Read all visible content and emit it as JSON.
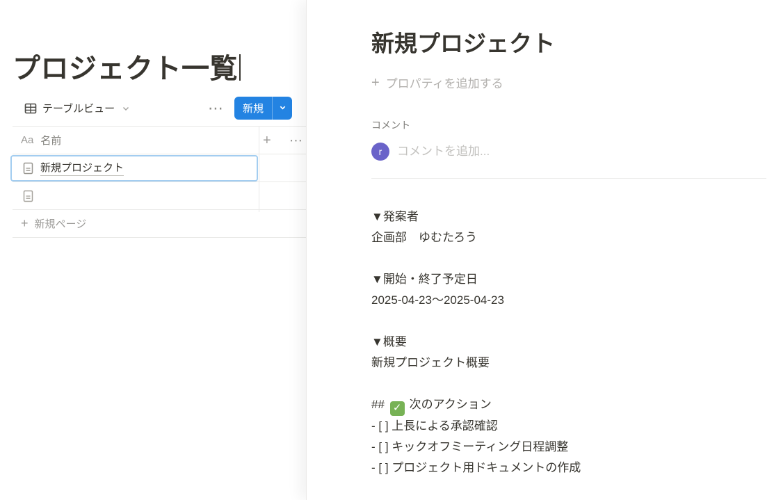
{
  "left_pane": {
    "page_title": "プロジェクト一覧",
    "toolbar": {
      "view_tab": "テーブルビュー",
      "new_button": "新規"
    },
    "table": {
      "header": {
        "type_badge": "Aa",
        "name_column": "名前"
      },
      "rows": [
        {
          "title": "新規プロジェクト"
        },
        {
          "title": ""
        }
      ],
      "new_page_label": "新規ページ"
    }
  },
  "side_peek": {
    "page_title": "新規プロジェクト",
    "add_property_label": "プロパティを追加する",
    "comments": {
      "section_label": "コメント",
      "avatar_initial": "r",
      "placeholder": "コメントを追加..."
    },
    "body": {
      "proposer_heading": "▼発案者",
      "proposer_value": "企画部　ゆむたろう",
      "dates_heading": "▼開始・終了予定日",
      "dates_value": "2025-04-23〜2025-04-23",
      "summary_heading": "▼概要",
      "summary_value": "新規プロジェクト概要",
      "actions_heading_prefix": "## ",
      "actions_emoji_glyph": "✓",
      "actions_heading_text": "次のアクション",
      "todo_items": [
        "- [ ] 上長による承認確認",
        "- [ ] キックオフミーティング日程調整",
        "- [ ] プロジェクト用ドキュメントの作成"
      ]
    }
  },
  "icons": {
    "table_view_icon": "grid",
    "chevron_down_icon": "v",
    "more_icon": "⋯",
    "plus_icon": "+",
    "page_icon": "document",
    "check_emoji": "✅"
  },
  "colors": {
    "accent_blue": "#2383e2",
    "selection_outline": "#a3cdf0",
    "avatar_purple": "#6a63c9",
    "check_emoji_green": "#77b255",
    "text_primary": "#37352f",
    "text_gray": "#7f7e79",
    "text_placeholder": "#c2c1be",
    "table_border": "#e9e9e7"
  }
}
